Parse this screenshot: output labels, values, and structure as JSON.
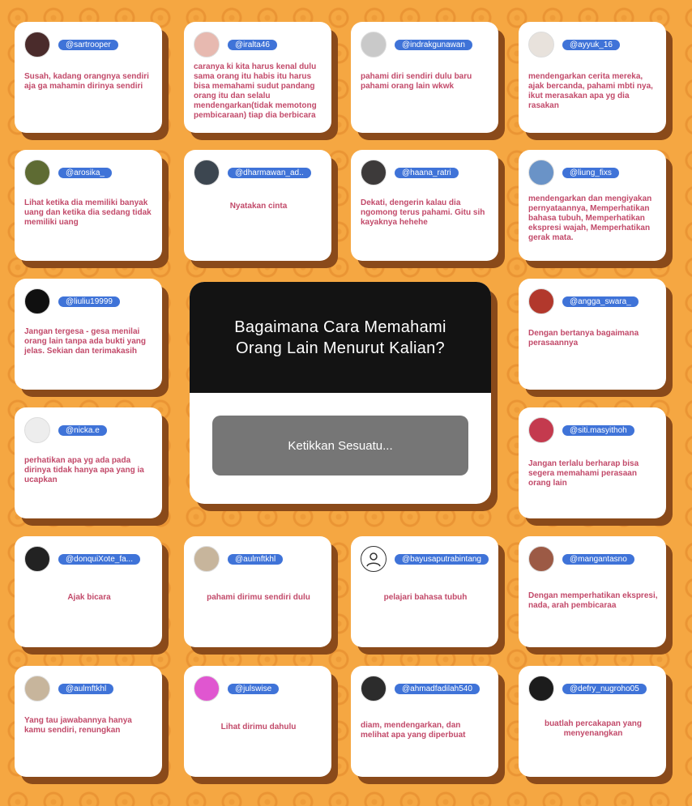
{
  "question": {
    "title": "Bagaimana Cara Memahami Orang Lain Menurut Kalian?",
    "input_placeholder": "Ketikkan Sesuatu..."
  },
  "cards": [
    {
      "handle": "@sartrooper",
      "answer": "Susah, kadang orangnya sendiri aja ga mahamin dirinya sendiri",
      "avatar_color": "#4a2b2b"
    },
    {
      "handle": "@iralta46",
      "answer": "caranya ki kita harus kenal dulu sama orang itu habis itu harus bisa memahami sudut pandang orang itu dan selalu mendengarkan(tidak memotong pembicaraan) tiap dia berbicara",
      "avatar_color": "#e7b9b0"
    },
    {
      "handle": "@indrakgunawan",
      "answer": "pahami diri sendiri dulu baru pahami orang lain wkwk",
      "avatar_color": "#c9c9c9"
    },
    {
      "handle": "@ayyuk_16",
      "answer": "mendengarkan cerita mereka, ajak bercanda, pahami mbti nya, ikut merasakan apa yg dia rasakan",
      "avatar_color": "#e8e2dc"
    },
    {
      "handle": "@arosika_",
      "answer": "Lihat ketika dia memiliki banyak uang dan ketika dia sedang tidak memiliki uang",
      "avatar_color": "#5e6b33"
    },
    {
      "handle": "@dharmawan_ad..",
      "answer": "Nyatakan cinta",
      "avatar_color": "#3c4650"
    },
    {
      "handle": "@haana_ratri",
      "answer": "Dekati, dengerin kalau dia ngomong terus pahami. Gitu sih kayaknya hehehe",
      "avatar_color": "#3d3a3a"
    },
    {
      "handle": "@liung_fixs",
      "answer": "mendengarkan dan mengiyakan pernyataannya, Memperhatikan bahasa tubuh, Memperhatikan ekspresi wajah, Memperhatikan gerak mata.",
      "avatar_color": "#6a93c7"
    },
    {
      "handle": "@liuliu19999",
      "answer": "Jangan tergesa - gesa menilai orang lain tanpa ada bukti yang jelas. Sekian dan terimakasih",
      "avatar_color": "#101010"
    },
    {
      "handle": "@angga_swara_",
      "answer": "Dengan bertanya bagaimana perasaannya",
      "avatar_color": "#b2382c"
    },
    {
      "handle": "@nicka.e",
      "answer": "perhatikan apa yg ada pada dirinya tidak hanya apa yang ia ucapkan",
      "avatar_color": "#ededed"
    },
    {
      "handle": "@siti.masyithoh",
      "answer": "Jangan terlalu berharap bisa segera memahami perasaan orang lain",
      "avatar_color": "#c43a4e"
    },
    {
      "handle": "@donquiXote_fa...",
      "answer": "Ajak bicara",
      "avatar_color": "#222222"
    },
    {
      "handle": "@aulmftkhl",
      "answer": "pahami dirimu sendiri dulu",
      "avatar_color": "#c7b59c"
    },
    {
      "handle": "@bayusaputrabintang",
      "answer": "pelajari bahasa tubuh",
      "avatar_color": "#ffffff"
    },
    {
      "handle": "@mangantasno",
      "answer": "Dengan memperhatikan ekspresi, nada, arah pembicaraa",
      "avatar_color": "#9c5a45"
    },
    {
      "handle": "@aulmftkhl",
      "answer": "Yang tau jawabannya hanya kamu sendiri, renungkan",
      "avatar_color": "#c7b59c"
    },
    {
      "handle": "@julswise",
      "answer": "Lihat dirimu dahulu",
      "avatar_color": "#e056d0"
    },
    {
      "handle": "@ahmadfadilah540",
      "answer": "diam, mendengarkan, dan melihat apa yang diperbuat",
      "avatar_color": "#2c2c2c"
    },
    {
      "handle": "@defry_nugroho05",
      "answer": "buatlah percakapan yang menyenangkan",
      "avatar_color": "#1c1c1c"
    }
  ]
}
